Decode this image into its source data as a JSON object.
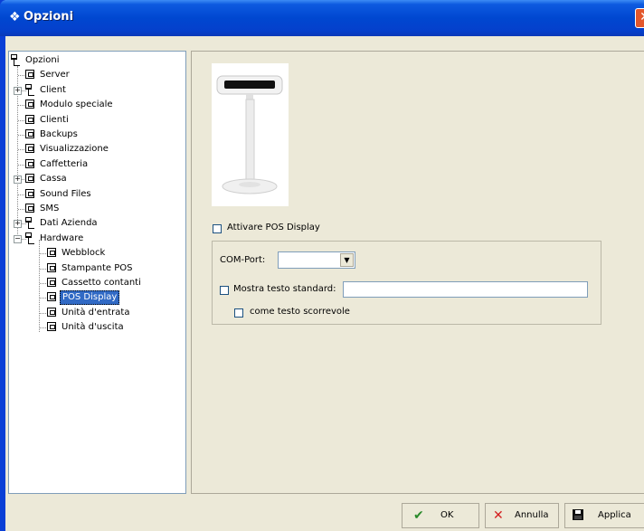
{
  "window": {
    "title": "Opzioni",
    "close_glyph": "✕"
  },
  "tree": [
    {
      "label": "Opzioni",
      "icon": "network-icon",
      "level": 0
    },
    {
      "label": "Server",
      "icon": "page-icon",
      "level": 1
    },
    {
      "label": "Client",
      "icon": "network-icon",
      "level": 1,
      "expander": "+"
    },
    {
      "label": "Modulo speciale",
      "icon": "page-icon",
      "level": 1
    },
    {
      "label": "Clienti",
      "icon": "page-icon",
      "level": 1
    },
    {
      "label": "Backups",
      "icon": "page-icon",
      "level": 1
    },
    {
      "label": "Visualizzazione",
      "icon": "page-icon",
      "level": 1
    },
    {
      "label": "Caffetteria",
      "icon": "page-icon",
      "level": 1
    },
    {
      "label": "Cassa",
      "icon": "page-icon",
      "level": 1,
      "expander": "+"
    },
    {
      "label": "Sound Files",
      "icon": "page-icon",
      "level": 1
    },
    {
      "label": "SMS",
      "icon": "page-icon",
      "level": 1
    },
    {
      "label": "Dati Azienda",
      "icon": "network-icon",
      "level": 1,
      "expander": "+"
    },
    {
      "label": "Hardware",
      "icon": "network-icon",
      "level": 1,
      "expander": "−"
    },
    {
      "label": "Webblock",
      "icon": "page-icon",
      "level": 2
    },
    {
      "label": "Stampante POS",
      "icon": "page-icon",
      "level": 2
    },
    {
      "label": "Cassetto contanti",
      "icon": "page-icon",
      "level": 2
    },
    {
      "label": "POS Display",
      "icon": "page-icon",
      "level": 2,
      "selected": true
    },
    {
      "label": "Unità d'entrata",
      "icon": "page-icon",
      "level": 2
    },
    {
      "label": "Unità d'uscita",
      "icon": "page-icon",
      "level": 2
    }
  ],
  "pos": {
    "activate_label": "Attivare POS Display",
    "activate_checked": false,
    "com_port_label": "COM-Port:",
    "com_port_value": "",
    "standard_text_label": "Mostra testo standard:",
    "standard_text_checked": false,
    "standard_text_value": "",
    "scroll_label": "come testo scorrevole",
    "scroll_checked": false
  },
  "buttons": {
    "ok": {
      "label": "OK",
      "icon": "checkmark-icon",
      "color": "#2a8a2a"
    },
    "cancel": {
      "label": "Annulla",
      "icon": "cross-icon",
      "color": "#d42020"
    },
    "apply": {
      "label": "Applica",
      "icon": "floppy-disk-icon",
      "color": "#000000"
    }
  }
}
